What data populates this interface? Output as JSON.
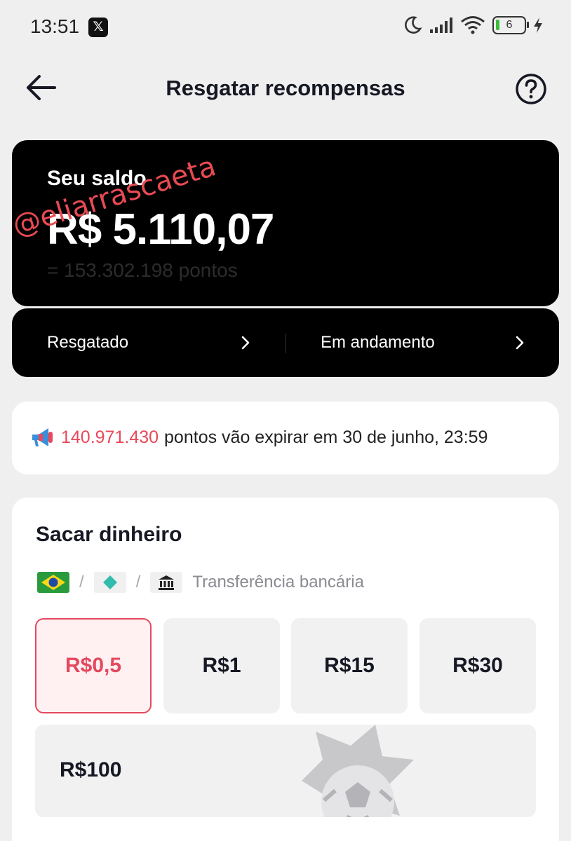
{
  "status_bar": {
    "time": "13:51",
    "battery": "6",
    "icons": [
      "x-app-icon",
      "moon-icon",
      "signal-icon",
      "wifi-icon",
      "battery-icon",
      "charging-icon"
    ]
  },
  "header": {
    "title": "Resgatar recompensas",
    "back_icon": "arrow-left-icon",
    "help_icon": "question-circle-icon"
  },
  "balance": {
    "label": "Seu saldo",
    "value": "R$ 5.110,07",
    "points": "= 153.302.198 pontos",
    "watermark": "@eliarrascaeta"
  },
  "links": {
    "redeemed": "Resgatado",
    "in_progress": "Em andamento"
  },
  "expiry": {
    "points": "140.971.430",
    "text": "pontos vão expirar em 30 de junho, 23:59"
  },
  "cash": {
    "title": "Sacar dinheiro",
    "method_label": "Transferência bancária",
    "amounts": [
      "R$0,5",
      "R$1",
      "R$15",
      "R$30",
      "R$100"
    ],
    "selected_index": 0
  },
  "colors": {
    "accent": "#e5485e",
    "card_dark": "#000000",
    "background": "#efefef"
  }
}
